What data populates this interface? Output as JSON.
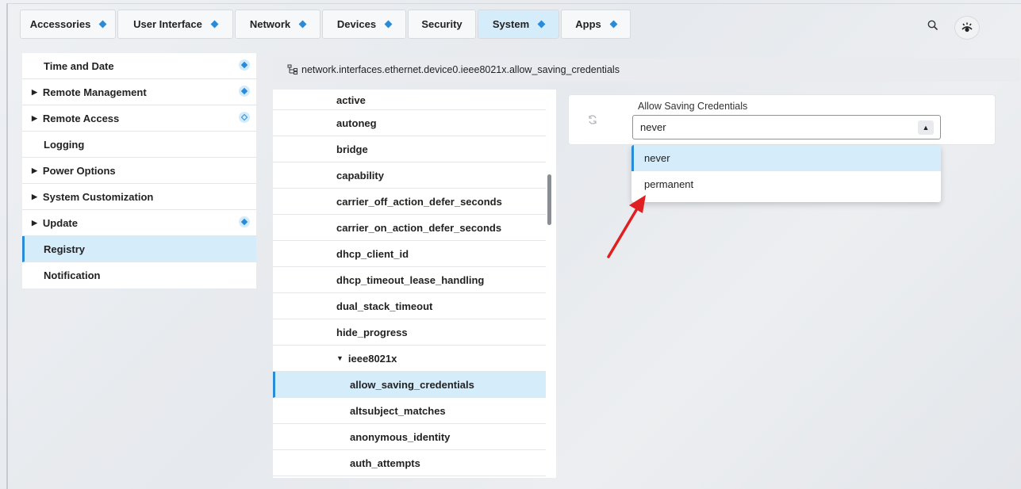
{
  "tabs": [
    {
      "label": "Accessories",
      "badge": true
    },
    {
      "label": "User Interface",
      "badge": true
    },
    {
      "label": "Network",
      "badge": true
    },
    {
      "label": "Devices",
      "badge": true
    },
    {
      "label": "Security",
      "badge": false
    },
    {
      "label": "System",
      "badge": true,
      "active": true
    },
    {
      "label": "Apps",
      "badge": true
    }
  ],
  "header": {
    "search_icon": "search-icon",
    "settings_icon": "settings-eye-icon"
  },
  "sidebar": {
    "items": [
      {
        "label": "Time and Date",
        "expandable": false,
        "badge": "filled"
      },
      {
        "label": "Remote Management",
        "expandable": true,
        "badge": "filled"
      },
      {
        "label": "Remote Access",
        "expandable": true,
        "badge": "outline"
      },
      {
        "label": "Logging",
        "expandable": false,
        "badge": null
      },
      {
        "label": "Power Options",
        "expandable": true,
        "badge": null
      },
      {
        "label": "System Customization",
        "expandable": true,
        "badge": null
      },
      {
        "label": "Update",
        "expandable": true,
        "badge": "filled"
      },
      {
        "label": "Registry",
        "expandable": false,
        "badge": null,
        "selected": true
      },
      {
        "label": "Notification",
        "expandable": false,
        "badge": null
      }
    ]
  },
  "breadcrumb": {
    "path": "network.interfaces.ethernet.device0.ieee8021x.allow_saving_credentials"
  },
  "tree": {
    "items": [
      {
        "label": "active",
        "level": 0
      },
      {
        "label": "autoneg",
        "level": 0
      },
      {
        "label": "bridge",
        "level": 0
      },
      {
        "label": "capability",
        "level": 0
      },
      {
        "label": "carrier_off_action_defer_seconds",
        "level": 0
      },
      {
        "label": "carrier_on_action_defer_seconds",
        "level": 0
      },
      {
        "label": "dhcp_client_id",
        "level": 0
      },
      {
        "label": "dhcp_timeout_lease_handling",
        "level": 0
      },
      {
        "label": "dual_stack_timeout",
        "level": 0
      },
      {
        "label": "hide_progress",
        "level": 0
      },
      {
        "label": "ieee8021x",
        "level": 0,
        "group": true
      },
      {
        "label": "allow_saving_credentials",
        "level": 1,
        "selected": true
      },
      {
        "label": "altsubject_matches",
        "level": 1
      },
      {
        "label": "anonymous_identity",
        "level": 1
      },
      {
        "label": "auth_attempts",
        "level": 1
      }
    ]
  },
  "editor": {
    "label": "Allow Saving Credentials",
    "value": "never",
    "options": [
      "never",
      "permanent"
    ],
    "highlighted_option": "never"
  },
  "colors": {
    "accent": "#2a8cd8",
    "selected_bg": "#d5ecfb",
    "annotation_arrow": "#e02020"
  }
}
